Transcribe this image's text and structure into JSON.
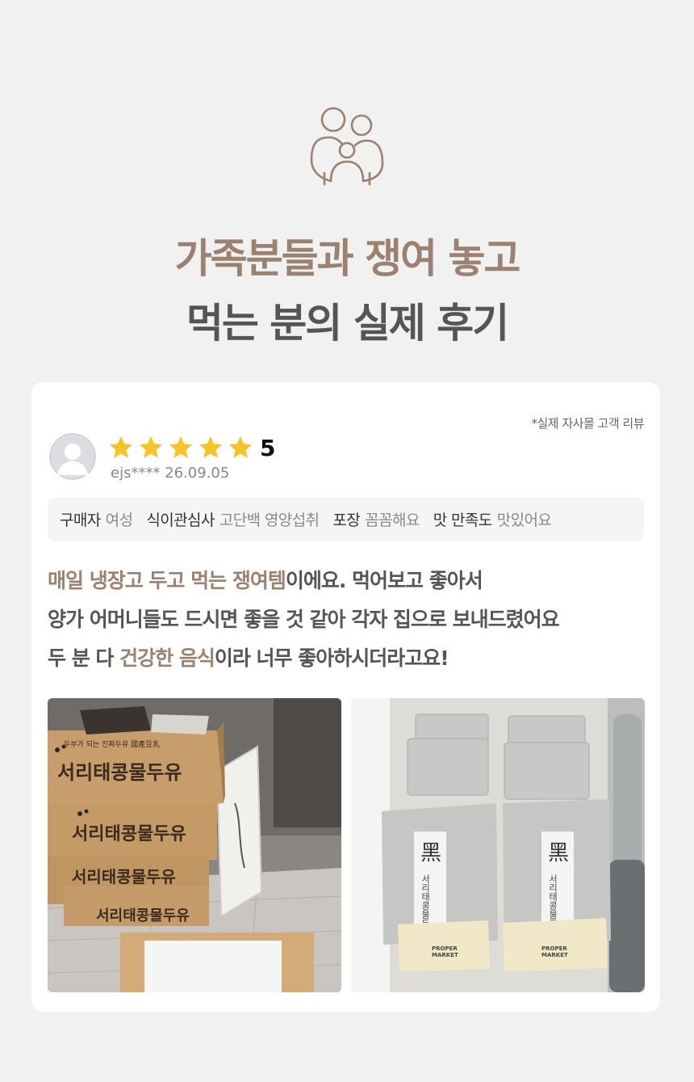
{
  "header": {
    "title_line1": "가족분들과 쟁여 놓고",
    "title_line2": "먹는 분의 실제 후기",
    "icon": "family-icon"
  },
  "review": {
    "note": "*실제 자사몰 고객 리뷰",
    "rating": "5",
    "rating_value": 5,
    "rating_max": 5,
    "reviewer": "ejs**** 26.09.05",
    "tags": [
      {
        "key": "구매자",
        "value": "여성"
      },
      {
        "key": "식이관심사",
        "value": "고단백 영양섭취"
      },
      {
        "key": "포장",
        "value": "꼼꼼해요"
      },
      {
        "key": "맛 만족도",
        "value": "맛있어요"
      }
    ],
    "text": {
      "line1_highlight": "매일 냉장고 두고 먹는 쟁여템",
      "line1_rest": "이에요. 먹어보고 좋아서",
      "line2": "양가 어머니들도 드시면 좋을 것 같아 각자 집으로 보내드렸어요",
      "line3_start": "두 분 다 ",
      "line3_highlight": "건강한 음식",
      "line3_rest": "이라 너무 좋아하시더라고요!"
    }
  },
  "photos": {
    "photo1": {
      "box_label": "서리태콩물두유",
      "box_subtitle": "두부가 되는 진짜두유 國產豆乳"
    },
    "photo2": {
      "pouch_label": "서리태콩물두유",
      "pouch_glyph": "黑",
      "brand_line1": "PROPER",
      "brand_line2": "MARKET"
    }
  },
  "colors": {
    "accent": "#9a8170",
    "text_dark": "#555555",
    "star": "#f7c325",
    "background": "#f1f1f1"
  }
}
